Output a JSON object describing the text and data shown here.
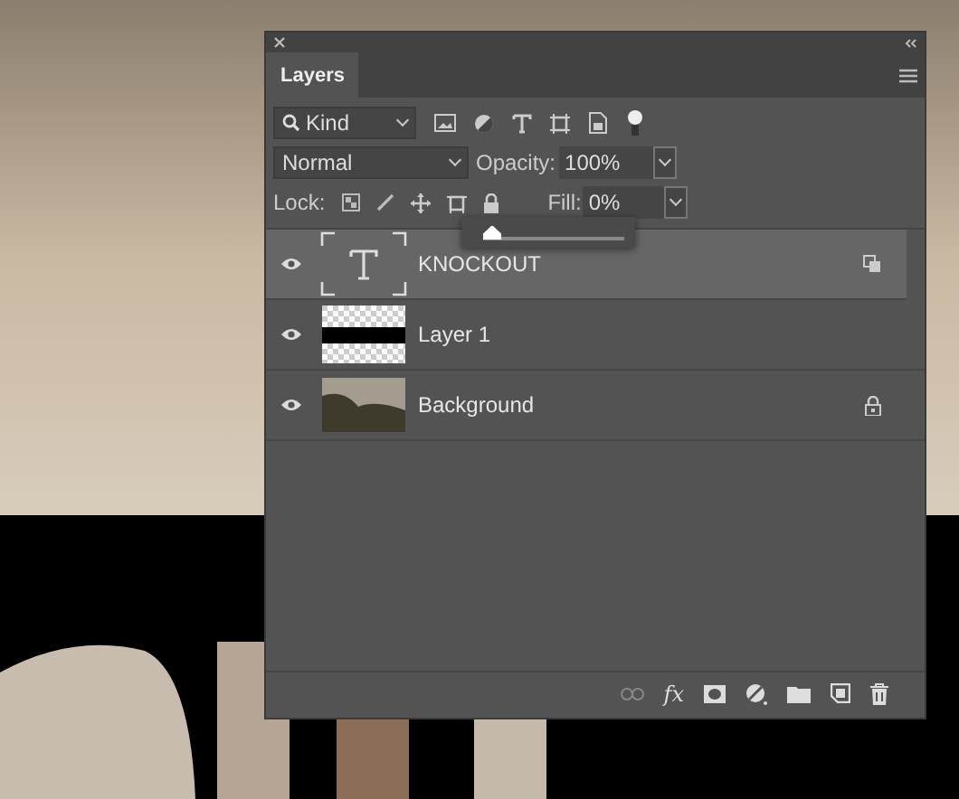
{
  "panel": {
    "tab": {
      "label": "Layers",
      "selected": true
    },
    "filter": {
      "value": "Kind"
    },
    "blend_mode": {
      "value": "Normal"
    },
    "opacity": {
      "label": "Opacity:",
      "value": "100%"
    },
    "lock": {
      "label": "Lock:"
    },
    "fill": {
      "label": "Fill:",
      "value": "0%"
    },
    "fill_slider": {
      "level": 0
    },
    "layers": [
      {
        "name": "KNOCKOUT",
        "kind": "text",
        "visible": true,
        "selected": true,
        "locked": false,
        "advanced_blending": true
      },
      {
        "name": "Layer 1",
        "kind": "pixel",
        "visible": true,
        "selected": false,
        "locked": false,
        "advanced_blending": false
      },
      {
        "name": "Background",
        "kind": "photo",
        "visible": true,
        "selected": false,
        "locked": true,
        "advanced_blending": false
      }
    ],
    "footer": {
      "effects_label": "fx"
    }
  }
}
